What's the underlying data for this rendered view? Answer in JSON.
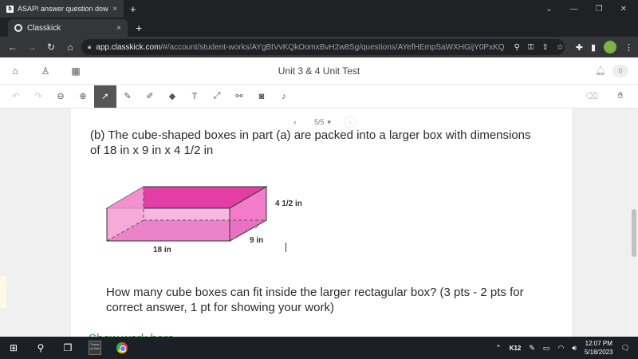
{
  "bg_window": {
    "tab_title": "ASAP! answer question down bel",
    "tab_close": "×",
    "new_tab": "+",
    "controls": [
      "⌄",
      "—",
      "❐",
      "✕"
    ]
  },
  "browser": {
    "tab_title": "Classkick",
    "tab_close": "×",
    "new_tab": "+",
    "url_host": "app.classkick.com",
    "url_path": "/#/account/student-works/AYgBtVvKQkOomxBvH2w8Sg/questions/AYefHEmpSaWXHGijY0PxKQ"
  },
  "app": {
    "title": "Unit 3 & 4 Unit Test",
    "notification_count": "0"
  },
  "pager": {
    "label": "5/5",
    "caret": "▾",
    "prev": "‹",
    "next": "›"
  },
  "question": {
    "part_b": "(b) The cube-shaped boxes in part (a) are packed into a larger box with dimensions of 18 in x 9 in x 4 1/2 in",
    "prompt": "How many cube boxes can fit inside the larger rectagular box? (3 pts - 2 pts for correct answer, 1 pt for showing your work)",
    "show_work": "Show work here"
  },
  "figure": {
    "height_label": "4  1/2 in",
    "depth_label": "9 in",
    "length_label": "18 in"
  },
  "taskbar": {
    "terms_label": "Terms of Use",
    "tray_label": "K12",
    "time": "12:07 PM",
    "date": "5/18/2023"
  },
  "colors": {
    "box_top": "#e23ea5",
    "box_side": "#f27cc9",
    "box_front": "#e76bc1",
    "accent_green": "#43a047"
  }
}
